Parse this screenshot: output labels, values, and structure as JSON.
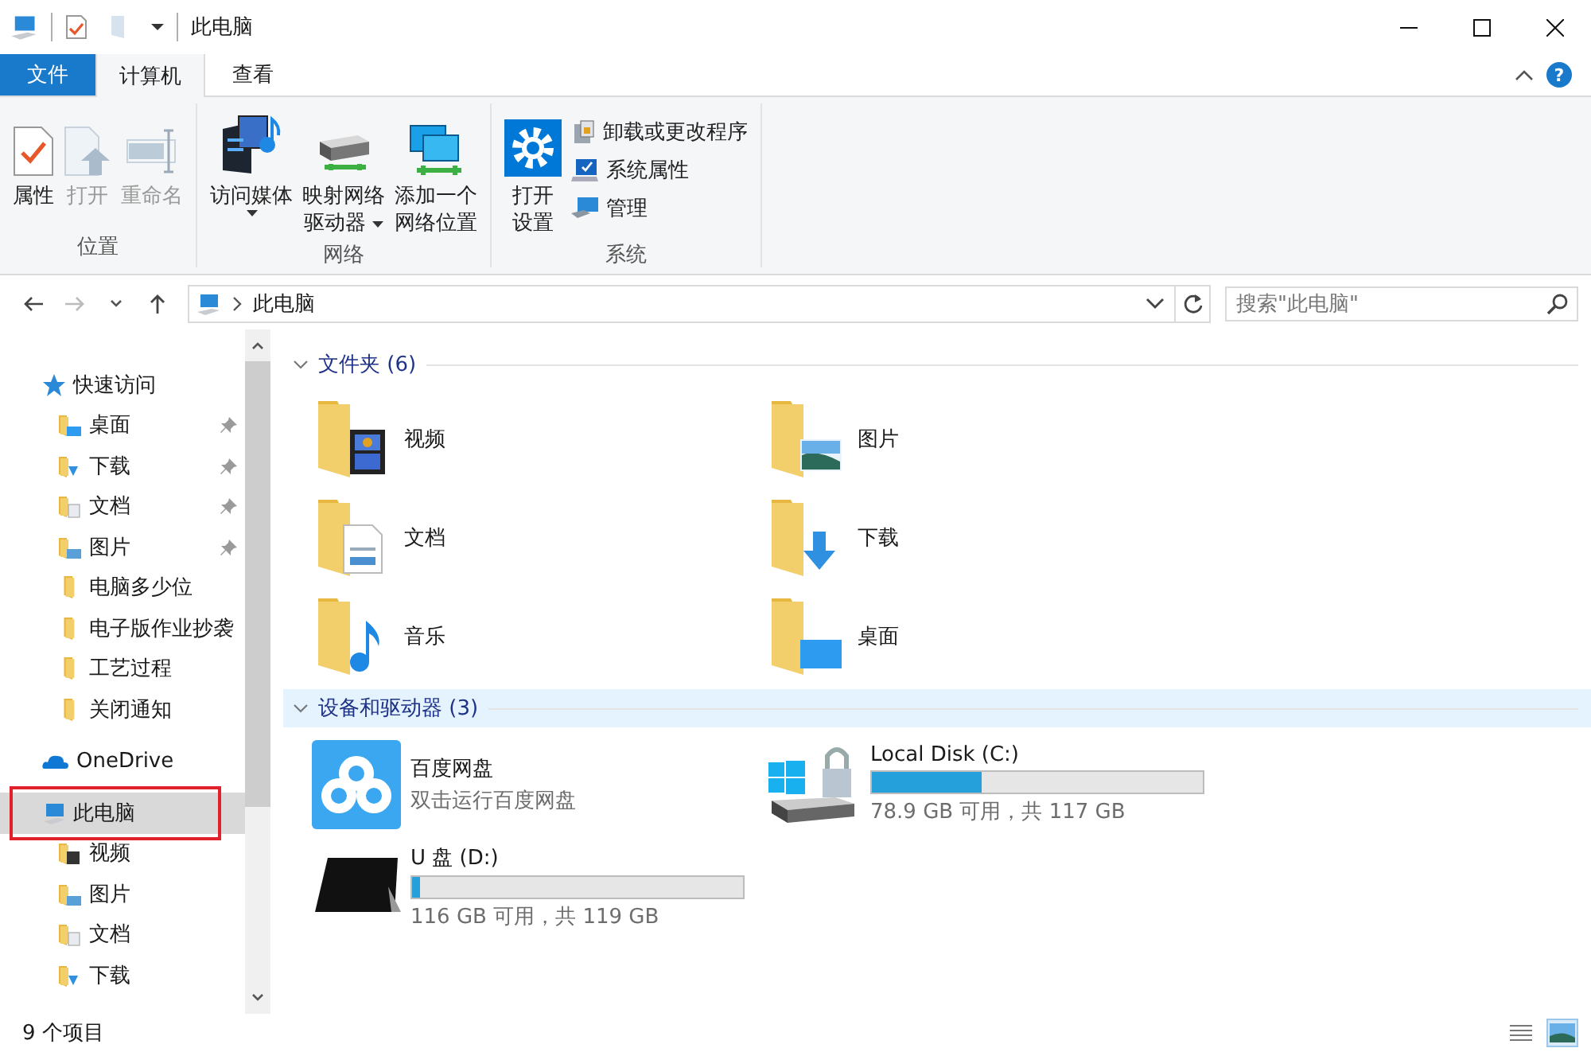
{
  "window": {
    "title": "此电脑"
  },
  "ribbon": {
    "tabs": [
      {
        "label": "文件",
        "kind": "file",
        "selected": false
      },
      {
        "label": "计算机",
        "kind": "tab",
        "selected": true
      },
      {
        "label": "查看",
        "kind": "tab",
        "selected": false
      }
    ],
    "help": "?",
    "groups": [
      {
        "label": "位置",
        "buttons": [
          {
            "lines": [
              "属性"
            ],
            "kind": "properties",
            "disabled": false,
            "dropdown": false
          },
          {
            "lines": [
              "打开"
            ],
            "kind": "open",
            "disabled": true,
            "dropdown": false
          },
          {
            "lines": [
              "重命名"
            ],
            "kind": "rename",
            "disabled": true,
            "dropdown": false
          }
        ]
      },
      {
        "label": "网络",
        "buttons": [
          {
            "lines": [
              "访问媒体"
            ],
            "kind": "media",
            "disabled": false,
            "dropdown": true
          },
          {
            "lines": [
              "映射网络",
              "驱动器"
            ],
            "kind": "map-drive",
            "disabled": false,
            "dropdown": true
          },
          {
            "lines": [
              "添加一个",
              "网络位置"
            ],
            "kind": "network-location",
            "disabled": false,
            "dropdown": false
          }
        ]
      },
      {
        "label": "系统",
        "buttons": [
          {
            "lines": [
              "打开",
              "设置"
            ],
            "kind": "settings",
            "disabled": false,
            "dropdown": false
          }
        ],
        "small_buttons": [
          {
            "label": "卸载或更改程序",
            "kind": "programs"
          },
          {
            "label": "系统属性",
            "kind": "system"
          },
          {
            "label": "管理",
            "kind": "manage"
          }
        ]
      }
    ]
  },
  "address": {
    "path": "此电脑",
    "search": {
      "placeholder": "搜索\"此电脑\""
    }
  },
  "navigation": [
    {
      "label": "快速访问",
      "kind": "star",
      "selected": false,
      "children": [
        {
          "label": "桌面",
          "kind": "desktop",
          "pinned": true,
          "selected": false
        },
        {
          "label": "下载",
          "kind": "download",
          "pinned": true,
          "selected": false
        },
        {
          "label": "文档",
          "kind": "document",
          "pinned": true,
          "selected": false
        },
        {
          "label": "图片",
          "kind": "picture",
          "pinned": true,
          "selected": false
        },
        {
          "label": "电脑多少位",
          "kind": "folder",
          "pinned": false,
          "selected": false
        },
        {
          "label": "电子版作业抄袭",
          "kind": "folder",
          "pinned": false,
          "selected": false
        },
        {
          "label": "工艺过程",
          "kind": "folder",
          "pinned": false,
          "selected": false
        },
        {
          "label": "关闭通知",
          "kind": "folder",
          "pinned": false,
          "selected": false
        }
      ]
    },
    {
      "label": "OneDrive",
      "kind": "cloud",
      "selected": false
    },
    {
      "label": "此电脑",
      "kind": "computer",
      "selected": true,
      "outlined": true,
      "children": [
        {
          "label": "视频",
          "kind": "video",
          "pinned": false,
          "selected": false
        },
        {
          "label": "图片",
          "kind": "picture",
          "pinned": false,
          "selected": false
        },
        {
          "label": "文档",
          "kind": "document",
          "pinned": false,
          "selected": false
        },
        {
          "label": "下载",
          "kind": "download",
          "pinned": false,
          "selected": false
        }
      ]
    }
  ],
  "sections": [
    {
      "title": "文件夹 (6)",
      "highlighted": false,
      "items": [
        {
          "label": "视频",
          "kind": "video"
        },
        {
          "label": "图片",
          "kind": "picture"
        },
        {
          "label": "文档",
          "kind": "document"
        },
        {
          "label": "下载",
          "kind": "download"
        },
        {
          "label": "音乐",
          "kind": "music"
        },
        {
          "label": "桌面",
          "kind": "desktop"
        }
      ]
    },
    {
      "title": "设备和驱动器 (3)",
      "highlighted": true,
      "items": [
        {
          "label": "百度网盘",
          "kind": "app",
          "subtitle": "双击运行百度网盘"
        },
        {
          "label": "Local Disk (C:)",
          "kind": "system-disk",
          "level": 0.33,
          "reading": "78.9 GB 可用，共 117 GB"
        },
        {
          "label": "U 盘 (D:)",
          "kind": "tablet",
          "level": 0.025,
          "reading": "116 GB 可用，共 119 GB"
        }
      ]
    }
  ],
  "status_bar": {
    "count": "9 个项目",
    "views": [
      {
        "kind": "details",
        "selected": false
      },
      {
        "kind": "large-icons",
        "selected": true
      }
    ]
  }
}
